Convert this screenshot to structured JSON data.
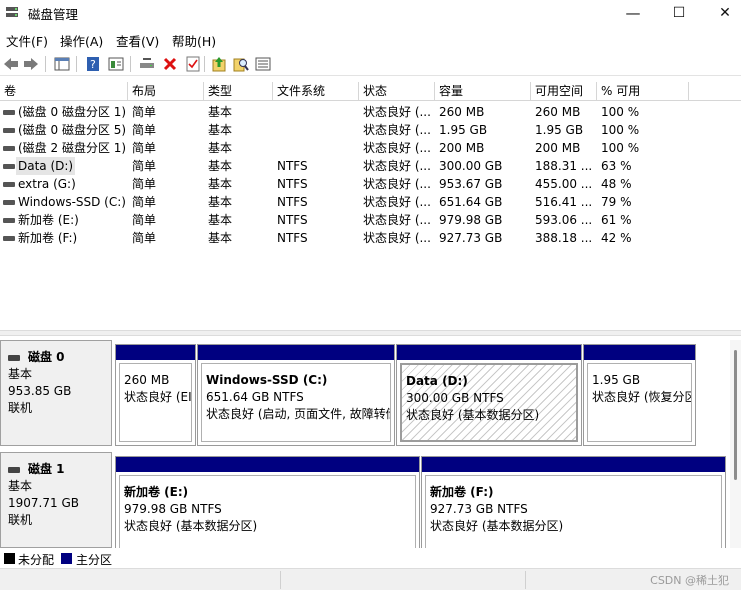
{
  "window": {
    "title": "磁盘管理",
    "minimize": "—",
    "maximize": "☐",
    "close": "✕"
  },
  "menu": [
    "文件(F)",
    "操作(A)",
    "查看(V)",
    "帮助(H)"
  ],
  "columns": [
    "卷",
    "布局",
    "类型",
    "文件系统",
    "状态",
    "容量",
    "可用空间",
    "% 可用"
  ],
  "volumes": [
    {
      "name": "(磁盘 0 磁盘分区 1)",
      "layout": "简单",
      "type": "基本",
      "fs": "",
      "status": "状态良好 (...",
      "capacity": "260 MB",
      "free": "260 MB",
      "pct": "100 %"
    },
    {
      "name": "(磁盘 0 磁盘分区 5)",
      "layout": "简单",
      "type": "基本",
      "fs": "",
      "status": "状态良好 (...",
      "capacity": "1.95 GB",
      "free": "1.95 GB",
      "pct": "100 %"
    },
    {
      "name": "(磁盘 2 磁盘分区 1)",
      "layout": "简单",
      "type": "基本",
      "fs": "",
      "status": "状态良好 (...",
      "capacity": "200 MB",
      "free": "200 MB",
      "pct": "100 %"
    },
    {
      "name": "Data (D:)",
      "layout": "简单",
      "type": "基本",
      "fs": "NTFS",
      "status": "状态良好 (...",
      "capacity": "300.00 GB",
      "free": "188.31 ...",
      "pct": "63 %"
    },
    {
      "name": "extra (G:)",
      "layout": "简单",
      "type": "基本",
      "fs": "NTFS",
      "status": "状态良好 (...",
      "capacity": "953.67 GB",
      "free": "455.00 ...",
      "pct": "48 %"
    },
    {
      "name": "Windows-SSD (C:)",
      "layout": "简单",
      "type": "基本",
      "fs": "NTFS",
      "status": "状态良好 (...",
      "capacity": "651.64 GB",
      "free": "516.41 ...",
      "pct": "79 %"
    },
    {
      "name": "新加卷 (E:)",
      "layout": "简单",
      "type": "基本",
      "fs": "NTFS",
      "status": "状态良好 (...",
      "capacity": "979.98 GB",
      "free": "593.06 ...",
      "pct": "61 %"
    },
    {
      "name": "新加卷 (F:)",
      "layout": "简单",
      "type": "基本",
      "fs": "NTFS",
      "status": "状态良好 (...",
      "capacity": "927.73 GB",
      "free": "388.18 ...",
      "pct": "42 %"
    }
  ],
  "disks": [
    {
      "name": "磁盘 0",
      "kind": "基本",
      "size": "953.85 GB",
      "state": "联机",
      "partitions": [
        {
          "title": "",
          "size": "260 MB",
          "status": "状态良好 (EI"
        },
        {
          "title": "Windows-SSD  (C:)",
          "size": "651.64 GB NTFS",
          "status": "状态良好 (启动, 页面文件, 故障转储"
        },
        {
          "title": "Data  (D:)",
          "size": "300.00 GB NTFS",
          "status": "状态良好 (基本数据分区)"
        },
        {
          "title": "",
          "size": "1.95 GB",
          "status": "状态良好 (恢复分区"
        }
      ]
    },
    {
      "name": "磁盘 1",
      "kind": "基本",
      "size": "1907.71 GB",
      "state": "联机",
      "partitions": [
        {
          "title": "新加卷  (E:)",
          "size": "979.98 GB NTFS",
          "status": "状态良好 (基本数据分区)"
        },
        {
          "title": "新加卷  (F:)",
          "size": "927.73 GB NTFS",
          "status": "状态良好 (基本数据分区)"
        }
      ]
    }
  ],
  "legend": {
    "unallocated": "未分配",
    "primary": "主分区"
  },
  "colors": {
    "primary": "#000080",
    "unallocated": "#000000"
  },
  "watermark": "CSDN @稀土犯"
}
